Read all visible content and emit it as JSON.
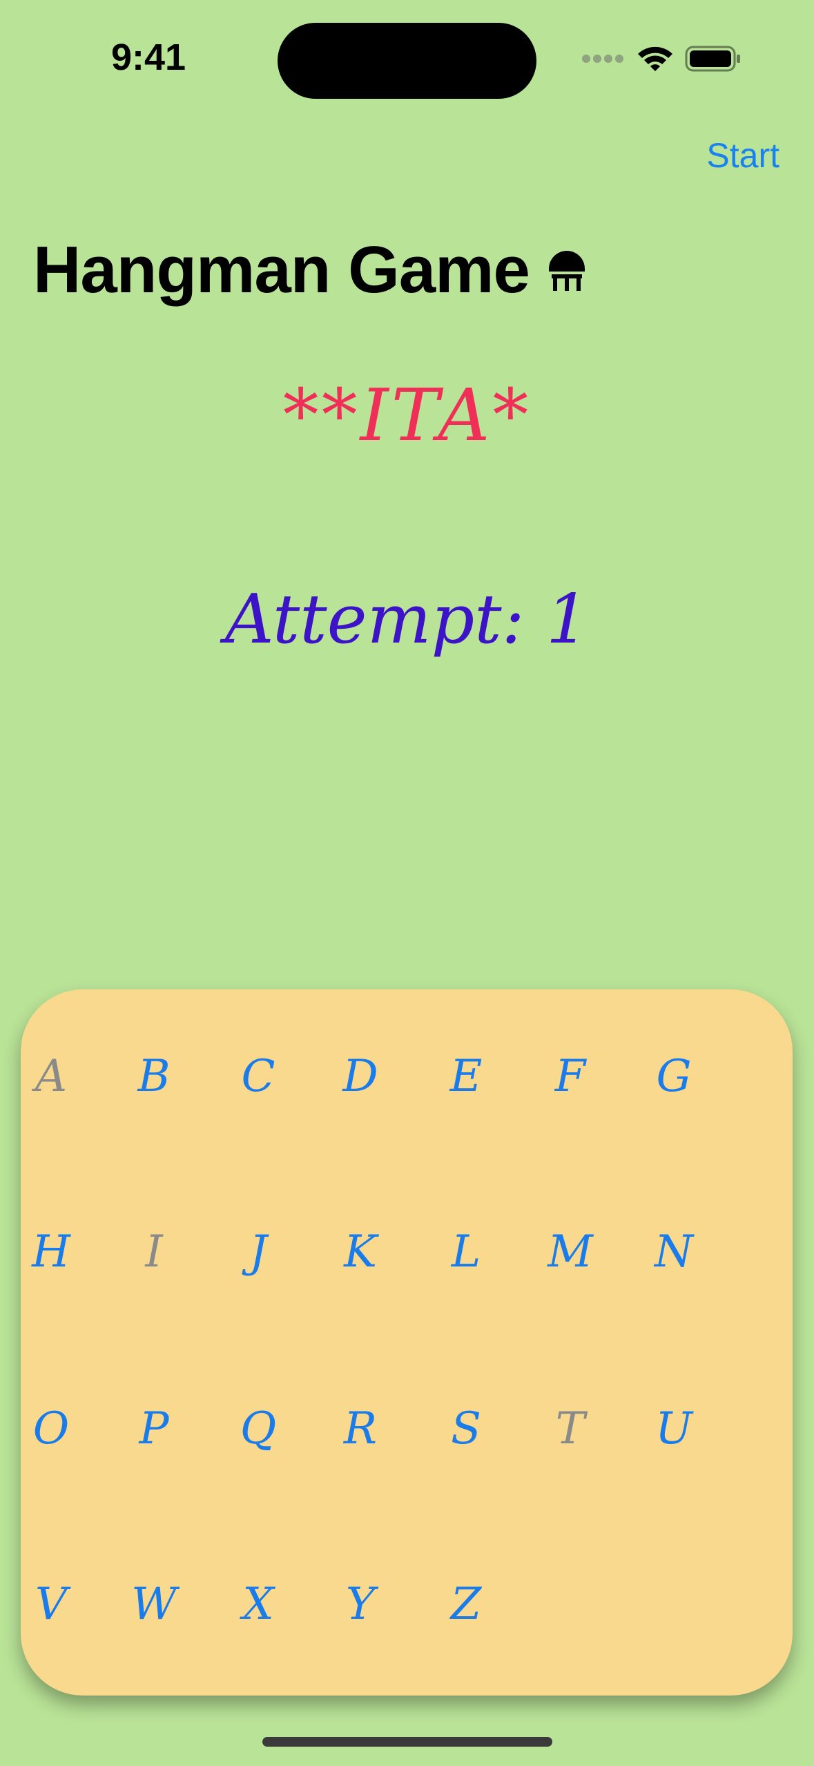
{
  "status_bar": {
    "time": "9:41",
    "icons": [
      "cellular-icon",
      "wifi-icon",
      "battery-icon"
    ]
  },
  "nav": {
    "start_label": "Start"
  },
  "header": {
    "title": "Hangman Game",
    "title_icon": "stool-icon"
  },
  "game": {
    "masked_word": "**ITA*",
    "attempt_text": "Attempt: 1"
  },
  "keyboard": {
    "keys": [
      {
        "letter": "A",
        "used": true
      },
      {
        "letter": "B",
        "used": false
      },
      {
        "letter": "C",
        "used": false
      },
      {
        "letter": "D",
        "used": false
      },
      {
        "letter": "E",
        "used": false
      },
      {
        "letter": "F",
        "used": false
      },
      {
        "letter": "G",
        "used": false
      },
      {
        "letter": "H",
        "used": false
      },
      {
        "letter": "I",
        "used": true
      },
      {
        "letter": "J",
        "used": false
      },
      {
        "letter": "K",
        "used": false
      },
      {
        "letter": "L",
        "used": false
      },
      {
        "letter": "M",
        "used": false
      },
      {
        "letter": "N",
        "used": false
      },
      {
        "letter": "O",
        "used": false
      },
      {
        "letter": "P",
        "used": false
      },
      {
        "letter": "Q",
        "used": false
      },
      {
        "letter": "R",
        "used": false
      },
      {
        "letter": "S",
        "used": false
      },
      {
        "letter": "T",
        "used": true
      },
      {
        "letter": "U",
        "used": false
      },
      {
        "letter": "V",
        "used": false
      },
      {
        "letter": "W",
        "used": false
      },
      {
        "letter": "X",
        "used": false
      },
      {
        "letter": "Y",
        "used": false
      },
      {
        "letter": "Z",
        "used": false
      }
    ]
  },
  "colors": {
    "background": "#b9e397",
    "keyboard_panel": "#f8d98d",
    "word": "#f02f59",
    "attempt": "#3c13c7",
    "key_active": "#1a7bea",
    "key_used": "#8a8a8a",
    "link": "#1a82f0"
  }
}
